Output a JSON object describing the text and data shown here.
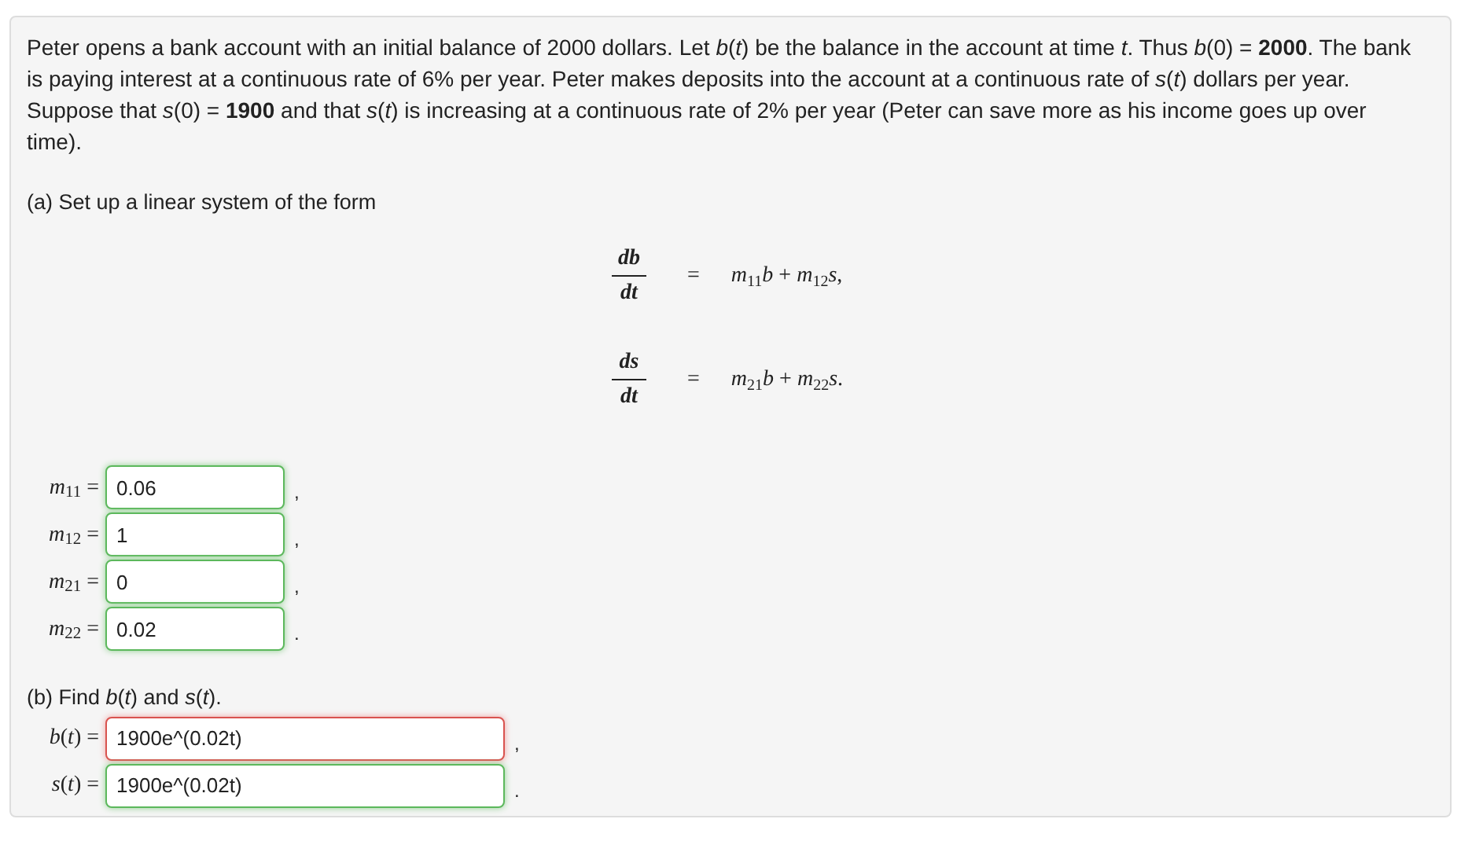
{
  "problem": {
    "intro": "Peter opens a bank account with an initial balance of 2000 dollars. Let *b*(*t*) be the balance in the account at time *t*. Thus *b*(0) = **2000**. The bank is paying interest at a continuous rate of 6% per year. Peter makes deposits into the account at a continuous rate of *s*(*t*) dollars per year. Suppose that *s*(0) = **1900** and that *s*(*t*) is increasing at a continuous rate of 2% per year (Peter can save more as his income goes up over time).",
    "part_a": "(a) Set up a linear system of the form",
    "equations": [
      {
        "numerator": "db",
        "denominator": "dt",
        "equals": "=",
        "rhs": "*m*$_{11}$*b* + *m*$_{12}$*s*,"
      },
      {
        "numerator": "ds",
        "denominator": "dt",
        "equals": "=",
        "rhs": "*m*$_{21}$*b* + *m*$_{22}$*s*."
      }
    ],
    "matrix_fields": [
      {
        "label": "*m*$_{11}$ =",
        "value": "0.06",
        "correct": true,
        "after": ","
      },
      {
        "label": "*m*$_{12}$ =",
        "value": "1",
        "correct": true,
        "after": ","
      },
      {
        "label": "*m*$_{21}$ =",
        "value": "0",
        "correct": true,
        "after": ","
      },
      {
        "label": "*m*$_{22}$ =",
        "value": "0.02",
        "correct": true,
        "after": "."
      }
    ],
    "part_b": "(b) Find *b*(*t*) and *s*(*t*).",
    "function_fields": [
      {
        "label": "*b*(*t*) =",
        "value": "1900e^(0.02t)",
        "correct": false,
        "after": ","
      },
      {
        "label": "*s*(*t*) =",
        "value": "1900e^(0.02t)",
        "correct": true,
        "after": "."
      }
    ]
  }
}
